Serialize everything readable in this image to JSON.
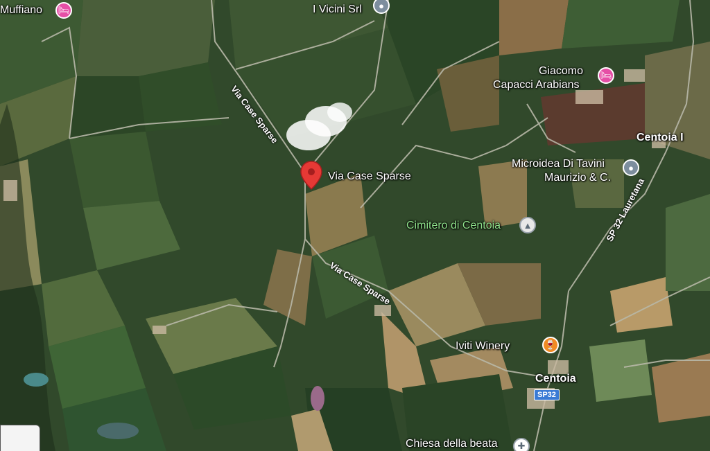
{
  "map": {
    "places": [
      {
        "key": "muffiano",
        "label": "Muffiano",
        "icon": "hotel-icon",
        "color": "#e64fa6"
      },
      {
        "key": "ivicini",
        "label": "I Vicini Srl",
        "icon": "location-icon",
        "color": "#7d8e9e"
      },
      {
        "key": "giacomo",
        "label": "Giacomo\nCapacci Arabians",
        "line1": "Giacomo",
        "line2": "Capacci Arabians",
        "icon": "hotel-icon",
        "color": "#e64fa6"
      },
      {
        "key": "centoia_i",
        "label": "Centoia I"
      },
      {
        "key": "microidea",
        "line1": "Microidea Di Tavini",
        "line2": "Maurizio & C.",
        "icon": "location-icon",
        "color": "#7d8e9e"
      },
      {
        "key": "selected",
        "label": "Via Case Sparse",
        "icon": "red-pin-icon",
        "color": "#e53935"
      },
      {
        "key": "cimitero",
        "label": "Cimitero di Centoia",
        "icon": "cemetery-icon",
        "color": "#8ee08a"
      },
      {
        "key": "iviti",
        "label": "Iviti Winery",
        "icon": "wine-glass-icon",
        "color": "#f08a24"
      },
      {
        "key": "centoia",
        "label": "Centoia"
      },
      {
        "key": "chiesa",
        "label": "Chiesa della beata",
        "icon": "church-icon"
      }
    ],
    "roads": [
      {
        "key": "road1",
        "label": "Via Case Sparse"
      },
      {
        "key": "road2",
        "label": "Via Case Sparse"
      },
      {
        "key": "sp32",
        "label": "SP 32 Lauretana"
      }
    ],
    "shield": "SP32"
  }
}
